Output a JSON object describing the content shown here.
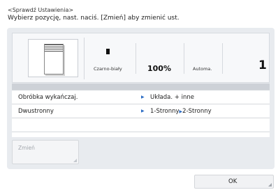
{
  "header": {
    "title": "<Sprawdź Ustawienia>",
    "instruction": "Wybierz pozycję, nast. naciś. [Zmień] aby zmienić ust."
  },
  "summary": {
    "color_mode": "Czarno-biały",
    "zoom": "100%",
    "paper": "Automa.",
    "copies": "1"
  },
  "settings": [
    {
      "label": "Obróbka wykańczaj.",
      "value": "Układa. + inne"
    },
    {
      "label": "Dwustronny",
      "value_left": "1-Stronny",
      "value_right": "2-Stronny"
    }
  ],
  "buttons": {
    "change": "Zmień",
    "ok": "OK"
  },
  "colors": {
    "accent": "#2b6cc4",
    "panel": "#e8ebef"
  },
  "icons": {
    "original": "document-icon",
    "color_mode": "black-white-icon",
    "arrow": "triangle-right-icon"
  }
}
